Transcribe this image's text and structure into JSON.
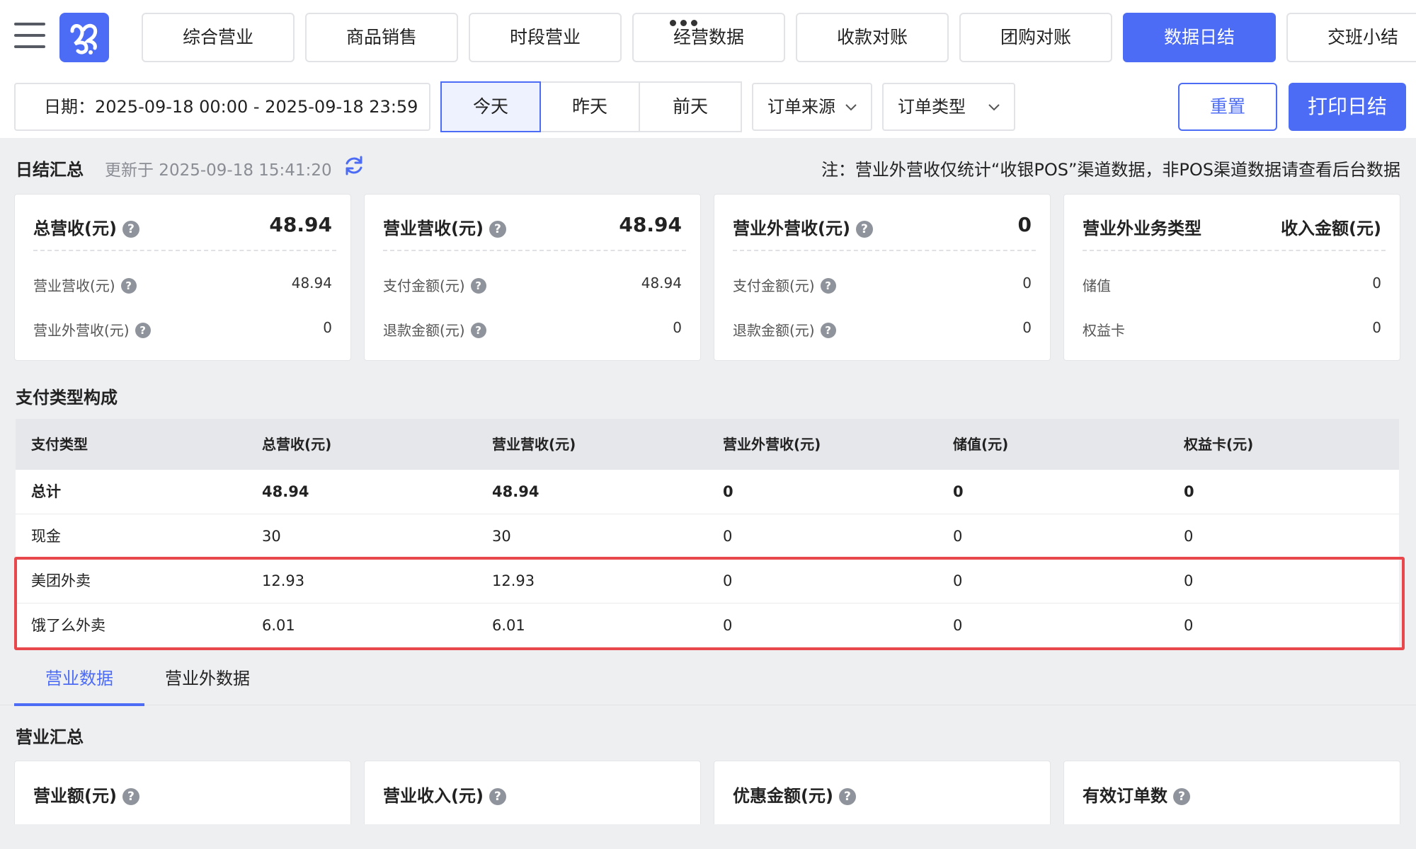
{
  "nav": {
    "tabs": [
      "综合营业",
      "商品销售",
      "时段营业",
      "经营数据",
      "收款对账",
      "团购对账",
      "数据日结",
      "交班小结"
    ],
    "active_index": 6
  },
  "filters": {
    "date_range": "日期：2025-09-18 00:00 - 2025-09-18 23:59",
    "day_buttons": [
      "今天",
      "昨天",
      "前天"
    ],
    "selected_day": "今天",
    "order_source": "订单来源",
    "order_type": "订单类型",
    "reset": "重置",
    "print": "打印日结"
  },
  "summary": {
    "title": "日结汇总",
    "updated": "更新于 2025-09-18 15:41:20",
    "note": "注：营业外营收仅统计“收银POS”渠道数据，非POS渠道数据请查看后台数据"
  },
  "cards": [
    {
      "title": "总营收(元)",
      "value": "48.94",
      "rows": [
        {
          "label": "营业营收(元)",
          "value": "48.94"
        },
        {
          "label": "营业外营收(元)",
          "value": "0"
        }
      ]
    },
    {
      "title": "营业营收(元)",
      "value": "48.94",
      "rows": [
        {
          "label": "支付金额(元)",
          "value": "48.94"
        },
        {
          "label": "退款金额(元)",
          "value": "0"
        }
      ]
    },
    {
      "title": "营业外营收(元)",
      "value": "0",
      "rows": [
        {
          "label": "支付金额(元)",
          "value": "0"
        },
        {
          "label": "退款金额(元)",
          "value": "0"
        }
      ]
    },
    {
      "title": "营业外业务类型",
      "value": "收入金额(元)",
      "rows": [
        {
          "label": "储值",
          "value": "0"
        },
        {
          "label": "权益卡",
          "value": "0"
        }
      ]
    }
  ],
  "payment": {
    "title": "支付类型构成",
    "columns": [
      "支付类型",
      "总营收(元)",
      "营业营收(元)",
      "营业外营收(元)",
      "储值(元)",
      "权益卡(元)"
    ],
    "rows": [
      [
        "总计",
        "48.94",
        "48.94",
        "0",
        "0",
        "0"
      ],
      [
        "现金",
        "30",
        "30",
        "0",
        "0",
        "0"
      ],
      [
        "美团外卖",
        "12.93",
        "12.93",
        "0",
        "0",
        "0"
      ],
      [
        "饿了么外卖",
        "6.01",
        "6.01",
        "0",
        "0",
        "0"
      ]
    ]
  },
  "subtabs": [
    "营业数据",
    "营业外数据"
  ],
  "business": {
    "title": "营业汇总",
    "cards": [
      "营业额(元)",
      "营业收入(元)",
      "优惠金额(元)",
      "有效订单数"
    ]
  },
  "colors": {
    "accent": "#4d6cf5",
    "highlight": "#e8474c",
    "background": "#eeeff1"
  }
}
